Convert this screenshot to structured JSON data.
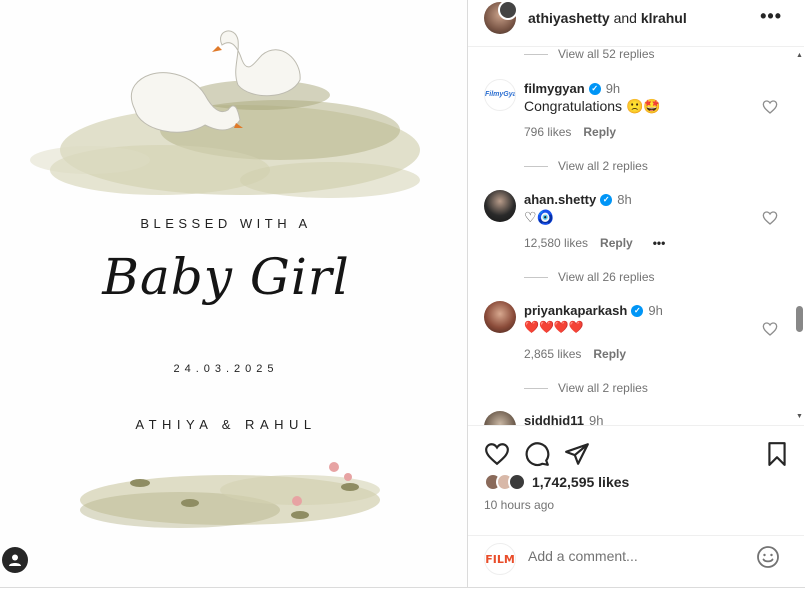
{
  "post": {
    "invite": {
      "blessed": "BLESSED WITH A",
      "script": "Baby Girl",
      "date": "24.03.2025",
      "names": "ATHIYA & RAHUL"
    }
  },
  "header": {
    "user1": "athiyashetty",
    "and": "and",
    "user2": "klrahul",
    "more": "•••"
  },
  "comments": {
    "replies_top": "View all 52 replies",
    "items": [
      {
        "username": "filmygyan",
        "time": "9h",
        "text": "Congratulations 🙁🤩",
        "likes": "796 likes",
        "reply": "Reply",
        "view_replies": "View all 2 replies",
        "avatar_text": "FilmyGyan"
      },
      {
        "username": "ahan.shetty",
        "time": "8h",
        "text": "♡🧿",
        "likes": "12,580 likes",
        "reply": "Reply",
        "more": "•••",
        "view_replies": "View all 26 replies"
      },
      {
        "username": "priyankaparkash",
        "time": "9h",
        "text": "❤️❤️❤️❤️",
        "likes": "2,865 likes",
        "reply": "Reply",
        "view_replies": "View all 2 replies"
      },
      {
        "username": "siddhid11",
        "time": "9h"
      }
    ]
  },
  "actions": {
    "likes": "1,742,595 likes",
    "time_ago": "10 hours ago"
  },
  "add_comment": {
    "avatar_text": "FILM",
    "placeholder": "Add a comment..."
  },
  "colors": {
    "verified": "#0095f6",
    "meta": "#737373",
    "heart": "#e0241b"
  }
}
